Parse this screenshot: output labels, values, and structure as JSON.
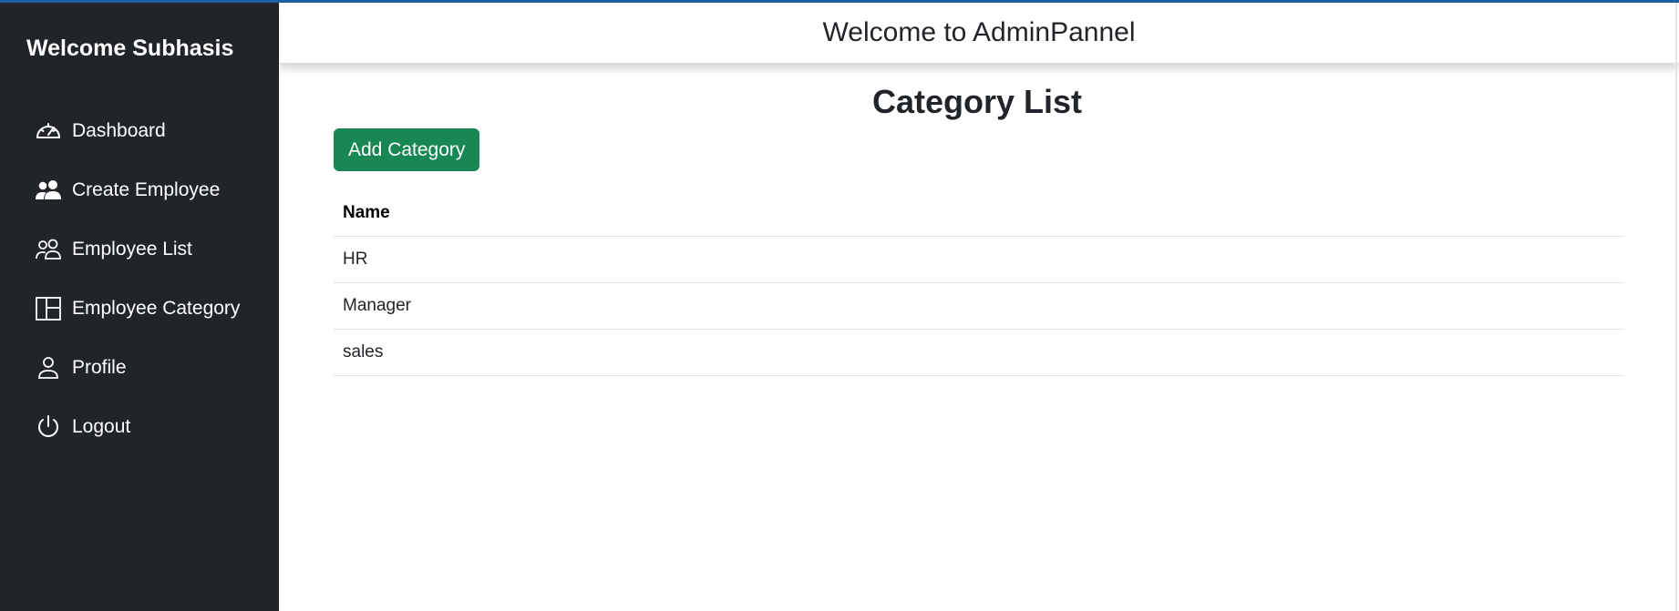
{
  "sidebar": {
    "brand": "Welcome Subhasis",
    "items": [
      {
        "label": "Dashboard",
        "icon": "speedometer-icon"
      },
      {
        "label": "Create Employee",
        "icon": "people-fill-icon"
      },
      {
        "label": "Employee List",
        "icon": "people-outline-icon"
      },
      {
        "label": "Employee Category",
        "icon": "layout-columns-icon"
      },
      {
        "label": "Profile",
        "icon": "person-icon"
      },
      {
        "label": "Logout",
        "icon": "power-icon"
      }
    ]
  },
  "header": {
    "title": "Welcome to AdminPannel"
  },
  "main": {
    "title": "Category List",
    "add_button": "Add Category",
    "table": {
      "columns": [
        "Name"
      ],
      "rows": [
        [
          "HR"
        ],
        [
          "Manager"
        ],
        [
          "sales"
        ]
      ]
    }
  },
  "colors": {
    "sidebar_bg": "#212529",
    "success_button": "#198754",
    "top_accent": "#1f5fa8"
  }
}
